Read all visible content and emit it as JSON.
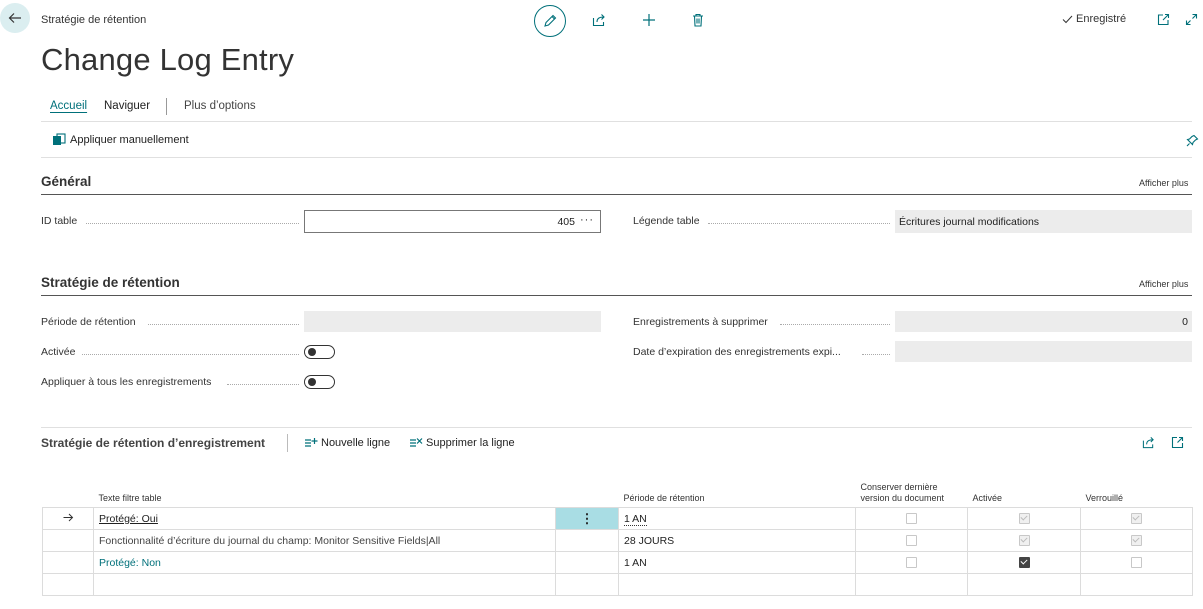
{
  "header": {
    "breadcrumb": "Stratégie de rétention",
    "title": "Change Log Entry",
    "saved_status": "Enregistré"
  },
  "menu": {
    "items": [
      "Accueil",
      "Naviguer",
      "Plus d’options"
    ]
  },
  "actions": {
    "apply_manually": "Appliquer manuellement"
  },
  "general": {
    "title": "Général",
    "show_more": "Afficher plus",
    "table_id_label": "ID table",
    "table_id_value": "405",
    "table_caption_label": "Légende table",
    "table_caption_value": "Écritures journal modifications"
  },
  "retention": {
    "title": "Stratégie de rétention",
    "show_more": "Afficher plus",
    "period_label": "Période de rétention",
    "period_value": "",
    "enabled_label": "Activée",
    "apply_all_label": "Appliquer à tous les enregistrements",
    "records_delete_label": "Enregistrements à supprimer",
    "records_delete_value": "0",
    "expiry_label": "Date d’expiration des enregistrements expi...",
    "expiry_value": ""
  },
  "record_retention": {
    "title": "Stratégie de rétention d’enregistrement",
    "new_line": "Nouvelle ligne",
    "delete_line": "Supprimer la ligne",
    "columns": {
      "filter_text": "Texte filtre table",
      "period": "Période de rétention",
      "keep_last_line1": "Conserver dernière",
      "keep_last_line2": "version du document",
      "enabled": "Activée",
      "locked": "Verrouillé"
    },
    "rows": [
      {
        "filter_text": "Protégé: Oui",
        "period": "1 AN",
        "keep_last": "unchecked",
        "enabled": "checked-dim",
        "locked": "checked-dim"
      },
      {
        "filter_text": "Fonctionnalité d’écriture du journal du champ: Monitor Sensitive Fields|All",
        "period": "28 JOURS",
        "keep_last": "unchecked",
        "enabled": "checked-dim",
        "locked": "checked-dim"
      },
      {
        "filter_text": "Protégé: Non",
        "period": "1 AN",
        "keep_last": "unchecked",
        "enabled": "checked",
        "locked": "unchecked"
      }
    ]
  },
  "colors": {
    "accent": "#00707a",
    "readonly_bg": "#ececec",
    "selected_cell": "#a9dde4"
  }
}
